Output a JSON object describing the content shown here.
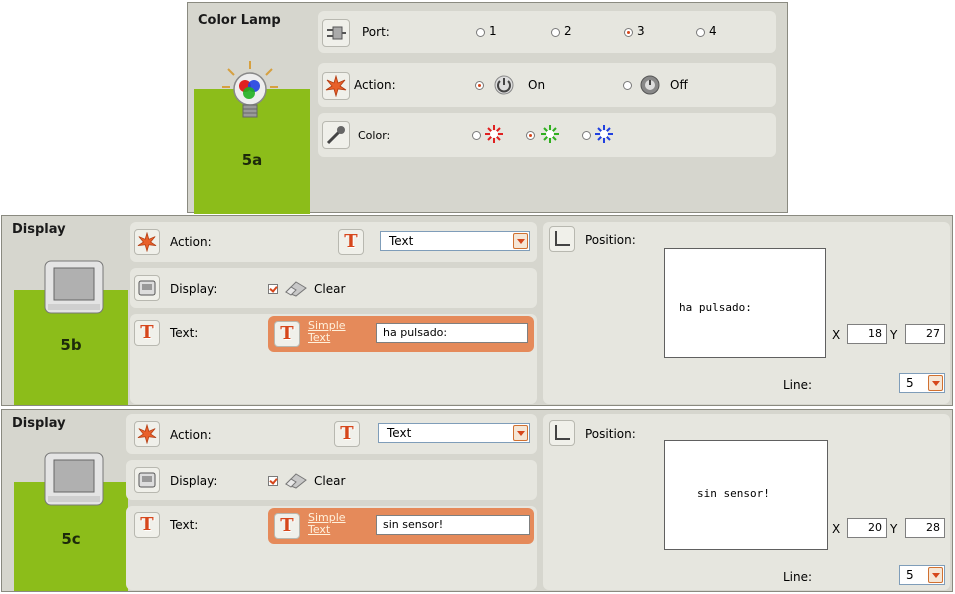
{
  "color_lamp": {
    "title": "Color Lamp",
    "block_label": "5a",
    "port_label": "Port:",
    "ports": [
      "1",
      "2",
      "3",
      "4"
    ],
    "port_selected": "3",
    "action_label": "Action:",
    "action_on": "On",
    "action_off": "Off",
    "action_selected": "On",
    "color_label": "Color:",
    "colors": [
      "red",
      "green",
      "blue"
    ],
    "color_selected": "green"
  },
  "display_b": {
    "title": "Display",
    "block_label": "5b",
    "action_label": "Action:",
    "action_value": "Text",
    "display_label": "Display:",
    "clear_label": "Clear",
    "clear_checked": true,
    "text_label": "Text:",
    "simple_text_link": "Simple Text",
    "text_value": "ha pulsado:",
    "position_label": "Position:",
    "preview_text": "ha pulsado:",
    "x_label": "X",
    "x_value": "18",
    "y_label": "Y",
    "y_value": "27",
    "line_label": "Line:",
    "line_value": "5"
  },
  "display_c": {
    "title": "Display",
    "block_label": "5c",
    "action_label": "Action:",
    "action_value": "Text",
    "display_label": "Display:",
    "clear_label": "Clear",
    "clear_checked": true,
    "text_label": "Text:",
    "simple_text_link": "Simple Text",
    "text_value": "sin sensor!",
    "position_label": "Position:",
    "preview_text": "sin sensor!",
    "x_label": "X",
    "x_value": "20",
    "y_label": "Y",
    "y_value": "28",
    "line_label": "Line:",
    "line_value": "5"
  },
  "colors": {
    "block_green": "#8cbd1a",
    "panel_bg": "#d6d6ce",
    "accent_orange": "#e58a5a",
    "radio_selected": "#d6471c"
  }
}
